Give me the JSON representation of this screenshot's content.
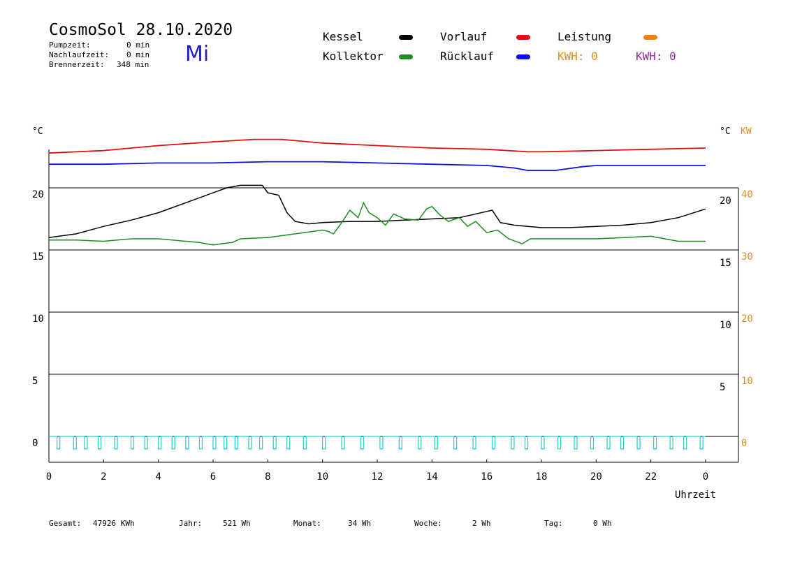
{
  "header": {
    "title": "CosmoSol 28.10.2020",
    "weekday": "Mi",
    "stats": [
      {
        "label": "Pumpzeit:",
        "value": "0 min"
      },
      {
        "label": "Nachlaufzeit:",
        "value": "0 min"
      },
      {
        "label": "Brennerzeit:",
        "value": "348 min"
      }
    ]
  },
  "legend": {
    "kessel": {
      "label": "Kessel",
      "color": "#000000"
    },
    "kollektor": {
      "label": "Kollektor",
      "color": "#1e8c1e"
    },
    "vorlauf": {
      "label": "Vorlauf",
      "color": "#e01010"
    },
    "ruecklauf": {
      "label": "Rücklauf",
      "color": "#1010e0"
    },
    "leistung": {
      "label": "Leistung",
      "color": "#f08010"
    },
    "kwh_orange": "KWH: 0",
    "kwh_purple": "KWH: 0",
    "kwh_orange_color": "#e09020",
    "kwh_purple_color": "#9030a0"
  },
  "axes": {
    "left_unit": "°C",
    "right_unit": "°C",
    "right_unit2": "KW",
    "xlabel": "Uhrzeit"
  },
  "footer": {
    "gesamt_label": "Gesamt:",
    "gesamt_value": "47926 KWh",
    "jahr_label": "Jahr:",
    "jahr_value": "521 Wh",
    "monat_label": "Monat:",
    "monat_value": "34 Wh",
    "woche_label": "Woche:",
    "woche_value": "2 Wh",
    "tag_label": "Tag:",
    "tag_value": "0 Wh"
  },
  "chart_data": {
    "type": "line",
    "xlim": [
      0,
      24
    ],
    "ylim": [
      -2,
      25
    ],
    "x_ticks": [
      0,
      2,
      4,
      6,
      8,
      10,
      12,
      14,
      16,
      18,
      20,
      22,
      24
    ],
    "x_tick_labels": [
      "0",
      "2",
      "4",
      "6",
      "8",
      "10",
      "12",
      "14",
      "16",
      "18",
      "20",
      "22",
      "0"
    ],
    "y_left_ticks": [
      0,
      5,
      10,
      15,
      20
    ],
    "y_left_labels": [
      "0",
      "5",
      "10",
      "15",
      "20"
    ],
    "y_right_ticks": [
      5,
      10,
      15,
      20
    ],
    "y_right_labels": [
      "5",
      "10",
      "15",
      "20"
    ],
    "y_kw_ticks": [
      0,
      5,
      10,
      15,
      20
    ],
    "y_kw_labels": [
      "0",
      "10",
      "20",
      "30",
      "40"
    ],
    "series": [
      {
        "name": "Vorlauf",
        "color": "#e01010",
        "x": [
          0,
          2,
          4,
          6,
          7.5,
          8.5,
          10,
          12,
          14,
          16,
          17.5,
          18,
          20,
          22,
          24
        ],
        "y": [
          22.8,
          23.0,
          23.4,
          23.7,
          23.9,
          23.9,
          23.6,
          23.4,
          23.2,
          23.1,
          22.9,
          22.9,
          23.0,
          23.1,
          23.2
        ]
      },
      {
        "name": "Rücklauf",
        "color": "#1010e0",
        "x": [
          0,
          2,
          4,
          6,
          8,
          10,
          12,
          14,
          16,
          17,
          17.5,
          18.5,
          19.5,
          20,
          22,
          24
        ],
        "y": [
          21.9,
          21.9,
          22.0,
          22.0,
          22.1,
          22.1,
          22.0,
          21.9,
          21.8,
          21.6,
          21.4,
          21.4,
          21.7,
          21.8,
          21.8,
          21.8
        ]
      },
      {
        "name": "Kessel",
        "color": "#000000",
        "x": [
          0,
          1,
          2,
          3,
          4,
          5,
          6,
          6.5,
          7,
          7.8,
          8.0,
          8.4,
          8.7,
          9.0,
          9.5,
          10,
          11,
          12,
          13,
          14,
          15,
          16,
          16.2,
          16.5,
          17,
          17.5,
          18,
          19,
          20,
          21,
          22,
          23,
          24
        ],
        "y": [
          16.0,
          16.3,
          16.9,
          17.4,
          18.0,
          18.8,
          19.6,
          20.0,
          20.2,
          20.2,
          19.6,
          19.4,
          18.0,
          17.3,
          17.1,
          17.2,
          17.3,
          17.3,
          17.4,
          17.5,
          17.6,
          18.1,
          18.2,
          17.2,
          17.0,
          16.9,
          16.8,
          16.8,
          16.9,
          17.0,
          17.2,
          17.6,
          18.3
        ]
      },
      {
        "name": "Kollektor",
        "color": "#1e8c1e",
        "x": [
          0,
          1,
          2,
          3,
          4,
          5,
          5.5,
          6,
          6.3,
          6.7,
          7,
          8,
          9,
          10,
          10.2,
          10.4,
          10.7,
          11,
          11.3,
          11.5,
          11.7,
          12,
          12.3,
          12.6,
          13,
          13.5,
          13.8,
          14,
          14.3,
          14.6,
          15,
          15.3,
          15.6,
          16,
          16.4,
          16.8,
          17.3,
          17.6,
          18,
          19,
          20,
          21,
          22,
          23,
          24
        ],
        "y": [
          15.8,
          15.8,
          15.7,
          15.9,
          15.9,
          15.7,
          15.6,
          15.4,
          15.5,
          15.6,
          15.9,
          16.0,
          16.3,
          16.6,
          16.5,
          16.3,
          17.2,
          18.2,
          17.6,
          18.8,
          18.0,
          17.6,
          17.0,
          17.9,
          17.5,
          17.4,
          18.3,
          18.5,
          17.8,
          17.3,
          17.6,
          16.9,
          17.3,
          16.4,
          16.6,
          15.9,
          15.5,
          15.9,
          15.9,
          15.9,
          15.9,
          16.0,
          16.1,
          15.7,
          15.7
        ]
      }
    ],
    "pump_pulses": {
      "name": "Leistung",
      "color": "#30d0d0",
      "baseline": 0,
      "pulse_depth": -1.0,
      "pulse_times": [
        0.3,
        0.9,
        1.3,
        1.8,
        2.4,
        3.0,
        3.5,
        4.0,
        4.5,
        5.0,
        5.5,
        6.0,
        6.4,
        6.8,
        7.3,
        7.7,
        8.2,
        8.7,
        9.3,
        10.0,
        10.7,
        11.4,
        12.1,
        12.8,
        13.5,
        14.1,
        14.8,
        15.5,
        16.2,
        16.9,
        17.4,
        18.0,
        18.6,
        19.2,
        19.8,
        20.4,
        20.9,
        21.5,
        22.1,
        22.7,
        23.2,
        23.8
      ]
    }
  }
}
